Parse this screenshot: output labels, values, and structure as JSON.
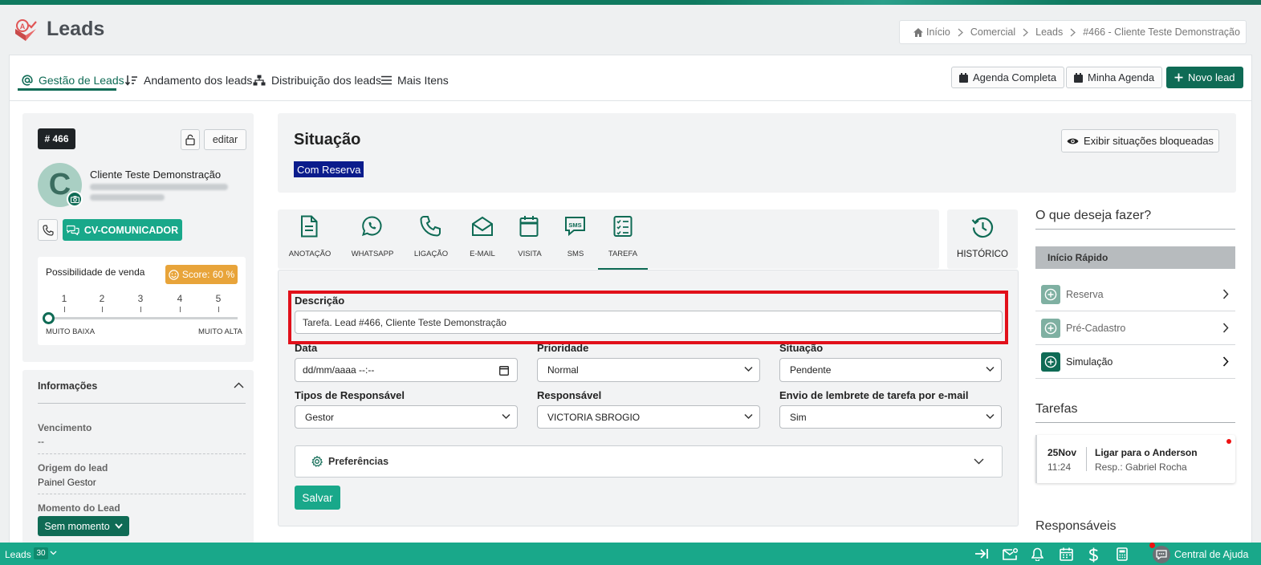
{
  "header": {
    "title": "Leads"
  },
  "breadcrumb": [
    {
      "label": "Início"
    },
    {
      "label": "Comercial"
    },
    {
      "label": "Leads"
    },
    {
      "label": "#466 - Cliente Teste Demonstração"
    }
  ],
  "tabs": [
    {
      "label": "Gestão de Leads",
      "icon": "at-icon"
    },
    {
      "label": "Andamento dos leads",
      "icon": "sort-icon"
    },
    {
      "label": "Distribuição dos leads",
      "icon": "hierarchy-icon"
    },
    {
      "label": "Mais Itens",
      "icon": "menu-icon"
    }
  ],
  "toolbar": {
    "agenda_completa": "Agenda Completa",
    "minha_agenda": "Minha Agenda",
    "novo_lead": "Novo lead"
  },
  "lead": {
    "badge": "# 466",
    "edit_label": "editar",
    "avatar_letter": "C",
    "name": "Cliente Teste Demonstração",
    "cv_button": "CV-COMUNICADOR",
    "possibility_label": "Possibilidade de venda",
    "score": "Score: 60 %",
    "scale": [
      "1",
      "2",
      "3",
      "4",
      "5"
    ],
    "scale_low": "MUITO BAIXA",
    "scale_high": "MUITO ALTA",
    "slider_value": 0
  },
  "info": {
    "title": "Informações",
    "fields": [
      {
        "label": "Vencimento",
        "value": "--"
      },
      {
        "label": "Origem do lead",
        "value": "Painel Gestor"
      },
      {
        "label": "Momento do Lead",
        "value": "Sem momento"
      }
    ]
  },
  "situacao": {
    "title": "Situação",
    "status": "Com Reserva",
    "blocked_button": "Exibir situações bloqueadas",
    "status_color": "#0b1c8c"
  },
  "actions": [
    {
      "label": "ANOTAÇÃO",
      "icon": "note-icon"
    },
    {
      "label": "WHATSAPP",
      "icon": "whatsapp-icon"
    },
    {
      "label": "LIGAÇÃO",
      "icon": "phone-icon"
    },
    {
      "label": "E-MAIL",
      "icon": "envelope-icon"
    },
    {
      "label": "VISITA",
      "icon": "calendar-icon"
    },
    {
      "label": "SMS",
      "icon": "sms-icon"
    },
    {
      "label": "TAREFA",
      "icon": "checklist-icon"
    }
  ],
  "history": {
    "label": "HISTÓRICO"
  },
  "form": {
    "descricao_label": "Descrição",
    "descricao_value": "Tarefa. Lead #466, Cliente Teste Demonstração",
    "data_label": "Data",
    "data_placeholder": "dd/mm/aaaa --:--",
    "prioridade_label": "Prioridade",
    "prioridade_value": "Normal",
    "situacao_label": "Situação",
    "situacao_value": "Pendente",
    "tipos_label": "Tipos de Responsável",
    "tipos_value": "Gestor",
    "responsavel_label": "Responsável",
    "responsavel_value": "VICTORIA SBROGIO",
    "envio_label": "Envio de lembrete de tarefa por e-mail",
    "envio_value": "Sim",
    "preferencias": "Preferências",
    "salvar": "Salvar"
  },
  "right": {
    "o_que": "O que deseja fazer?",
    "inicio_rapido": "Início Rápido",
    "quick": [
      {
        "label": "Reserva"
      },
      {
        "label": "Pré-Cadastro"
      },
      {
        "label": "Simulação"
      }
    ],
    "tarefas_title": "Tarefas",
    "task": {
      "day": "25Nov",
      "time": "11:24",
      "title": "Ligar para o Anderson",
      "resp": "Resp.: Gabriel Rocha"
    },
    "responsaveis_title": "Responsáveis"
  },
  "footer": {
    "label": "Leads",
    "count": "30",
    "help": "Central de Ajuda"
  },
  "colors": {
    "brand": "#0f6b55",
    "accent": "#19a88a",
    "score": "#e8a43a",
    "highlight": "#e1101a"
  }
}
